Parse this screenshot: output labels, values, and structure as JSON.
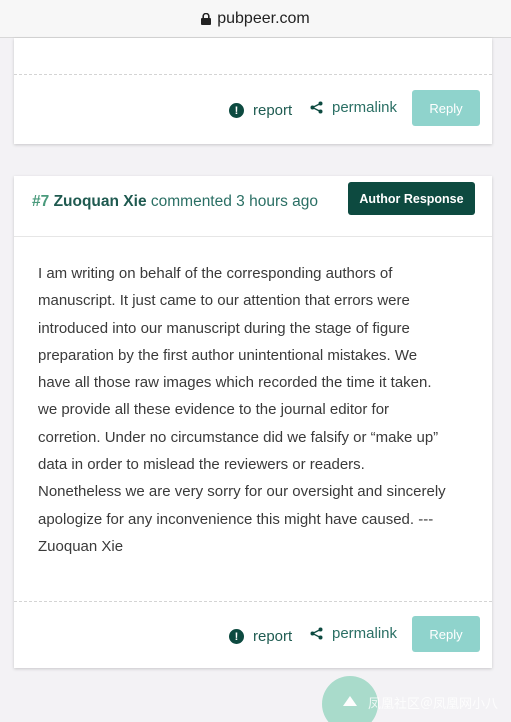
{
  "browser": {
    "url": "pubpeer.com",
    "lock_icon": "lock-icon"
  },
  "colors": {
    "accent_dark": "#0d4a40",
    "link_green": "#2a6f64",
    "reply_button": "#8fd3cc",
    "background": "#f3f2f5"
  },
  "previous_comment": {
    "report_label": "report",
    "permalink_label": "permalink",
    "reply_label": "Reply"
  },
  "comment": {
    "number": "#7",
    "author": "Zuoquan Xie",
    "meta": "commented 3 hours ago",
    "badge": "Author Response",
    "lines": [
      "I am writing on behalf of the corresponding authors of",
      "manuscript. It just came to our attention that errors were",
      "introduced into our manuscript during the stage of figure",
      "preparation by the first author unintentional mistakes. We",
      "have all those raw images which recorded the time it taken.",
      "we provide all these evidence to the journal editor for",
      "corretion. Under no circumstance did we falsify or “make up”",
      "data in order to mislead the reviewers or readers.",
      "Nonetheless we are very sorry for our oversight and sincerely",
      "apologize for any inconvenience this might have caused. ---",
      "Zuoquan Xie"
    ],
    "report_label": "report",
    "permalink_label": "permalink",
    "reply_label": "Reply"
  },
  "watermark": "凤凰社区＠凤凰网小八"
}
